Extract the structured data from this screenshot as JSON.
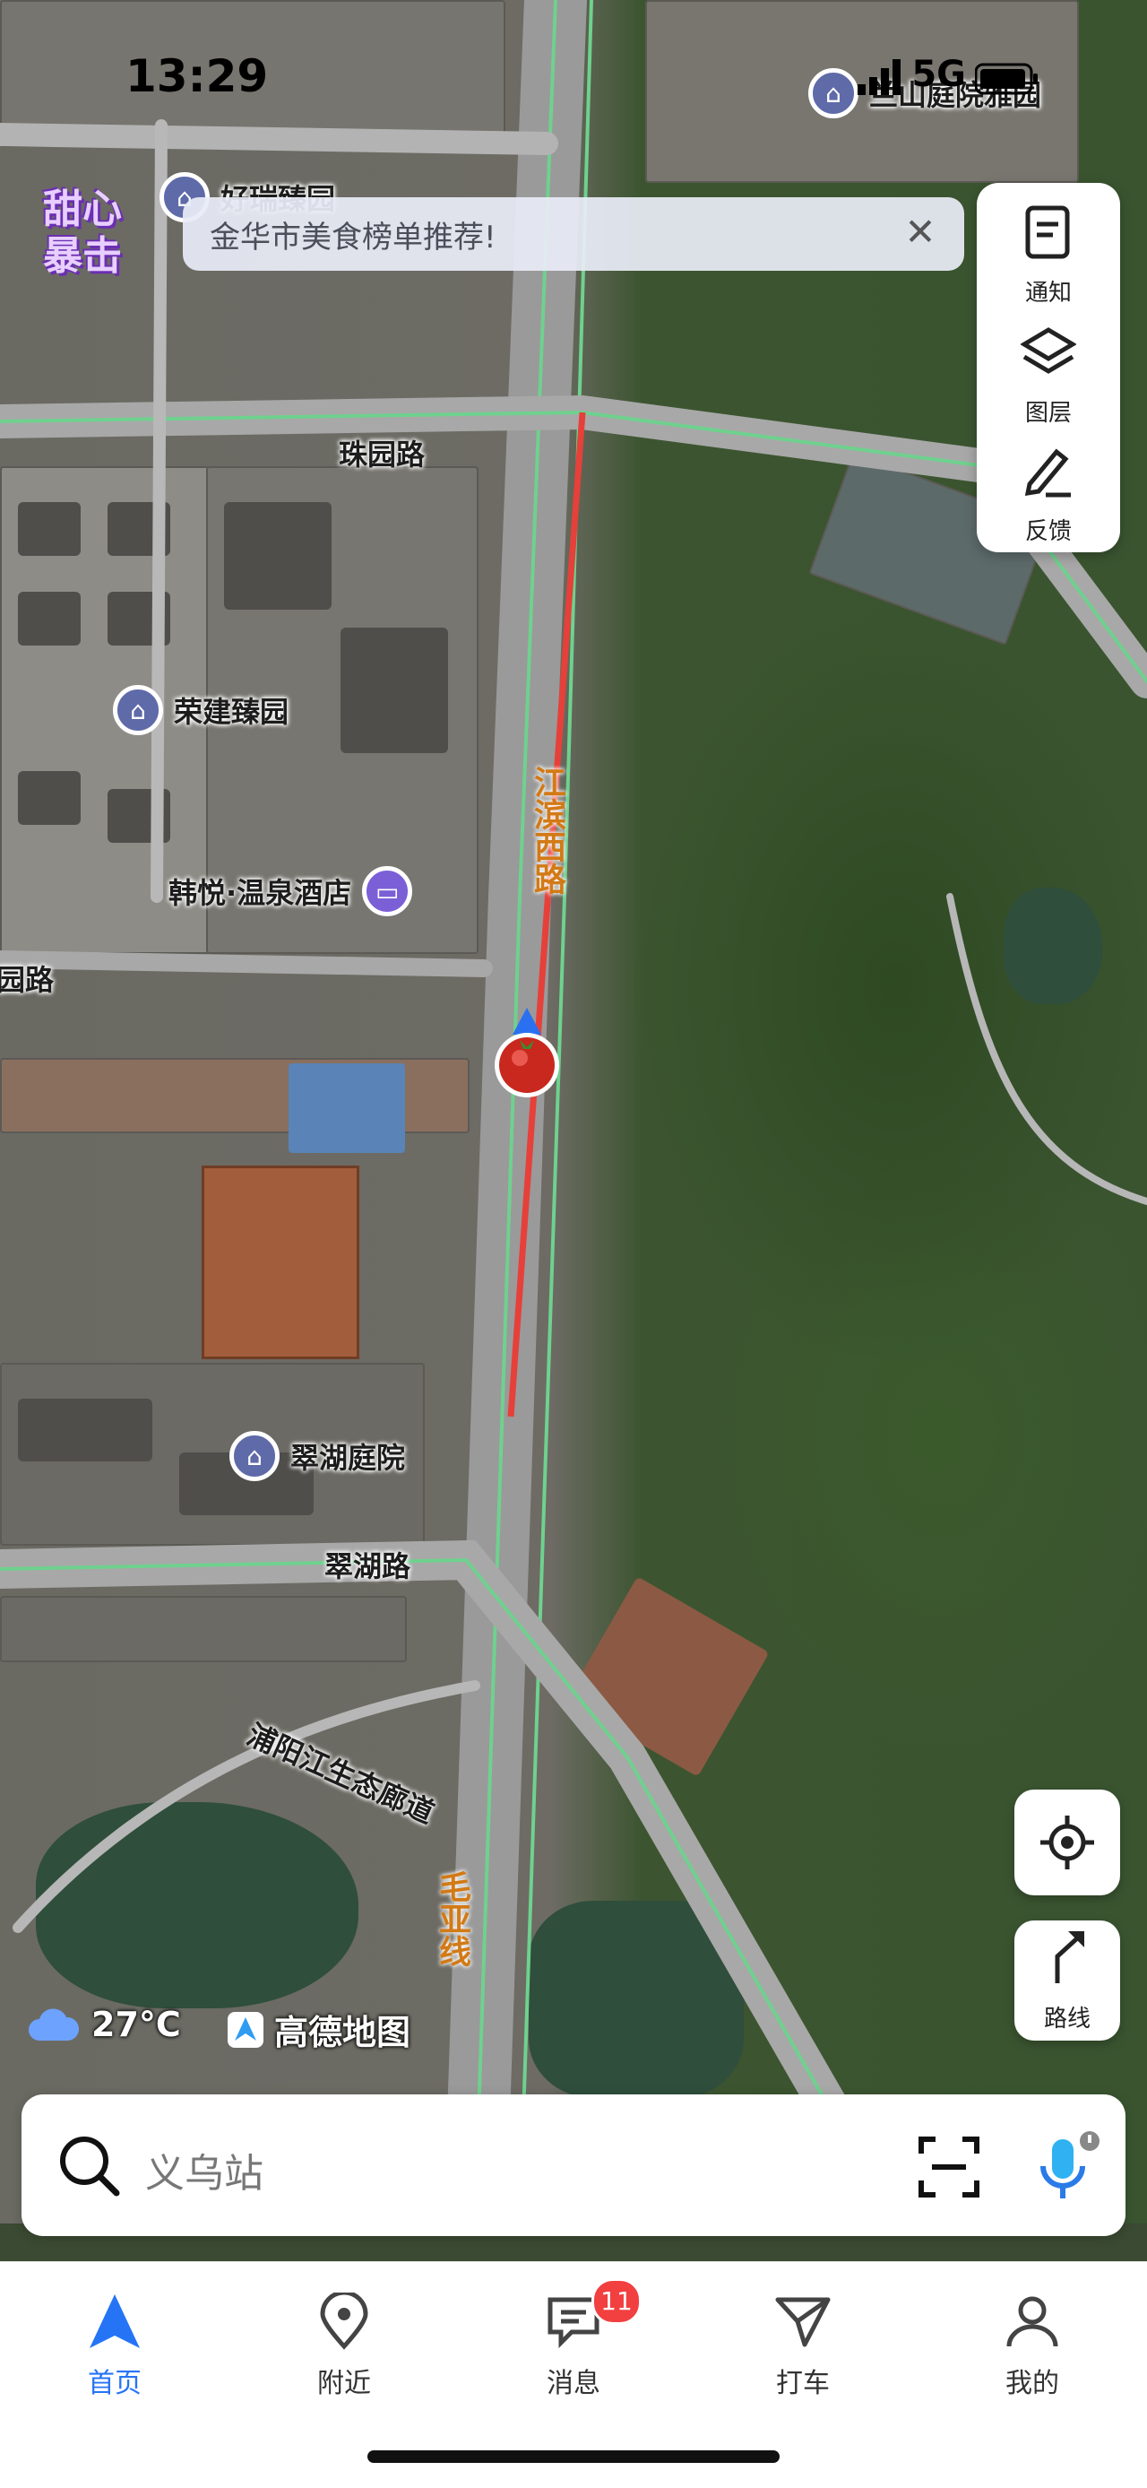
{
  "status_bar": {
    "time": "13:29",
    "network": "5G"
  },
  "brand_badge": "甜心暴击",
  "banner": {
    "text": "金华市美食榜单推荐!",
    "close_icon": "close-icon"
  },
  "map_labels": {
    "roads": {
      "zhuyuan": "珠园路",
      "jiangbin": "江滨西路",
      "cuihu_road": "翠湖路",
      "puyang": "浦阳江生态廊道",
      "maoya": "毛亚线",
      "partial_road": "园路"
    },
    "pois": {
      "lanshan": "兰山庭院雅园",
      "haorui": "好瑞臻园",
      "rongjian": "荣建臻园",
      "hanyue": "韩悦·温泉酒店",
      "cuihu_court": "翠湖庭院"
    }
  },
  "tools": [
    {
      "label": "通知",
      "icon": "notice-icon"
    },
    {
      "label": "图层",
      "icon": "layers-icon"
    },
    {
      "label": "反馈",
      "icon": "feedback-icon"
    }
  ],
  "route_button": {
    "label": "路线",
    "icon": "route-icon"
  },
  "weather": {
    "temp": "27°C",
    "icon": "cloud-icon"
  },
  "map_logo": "高德地图",
  "search": {
    "placeholder": "义乌站"
  },
  "tabs": [
    {
      "label": "首页",
      "icon": "home-arrow-icon",
      "active": true
    },
    {
      "label": "附近",
      "icon": "location-pin-icon",
      "active": false
    },
    {
      "label": "消息",
      "icon": "message-icon",
      "active": false,
      "badge": "11"
    },
    {
      "label": "打车",
      "icon": "taxi-icon",
      "active": false
    },
    {
      "label": "我的",
      "icon": "profile-icon",
      "active": false
    }
  ],
  "colors": {
    "accent": "#2674f6",
    "route_red": "#e6403a",
    "road_green": "#6fd18e",
    "badge_red": "#f23f3f"
  }
}
